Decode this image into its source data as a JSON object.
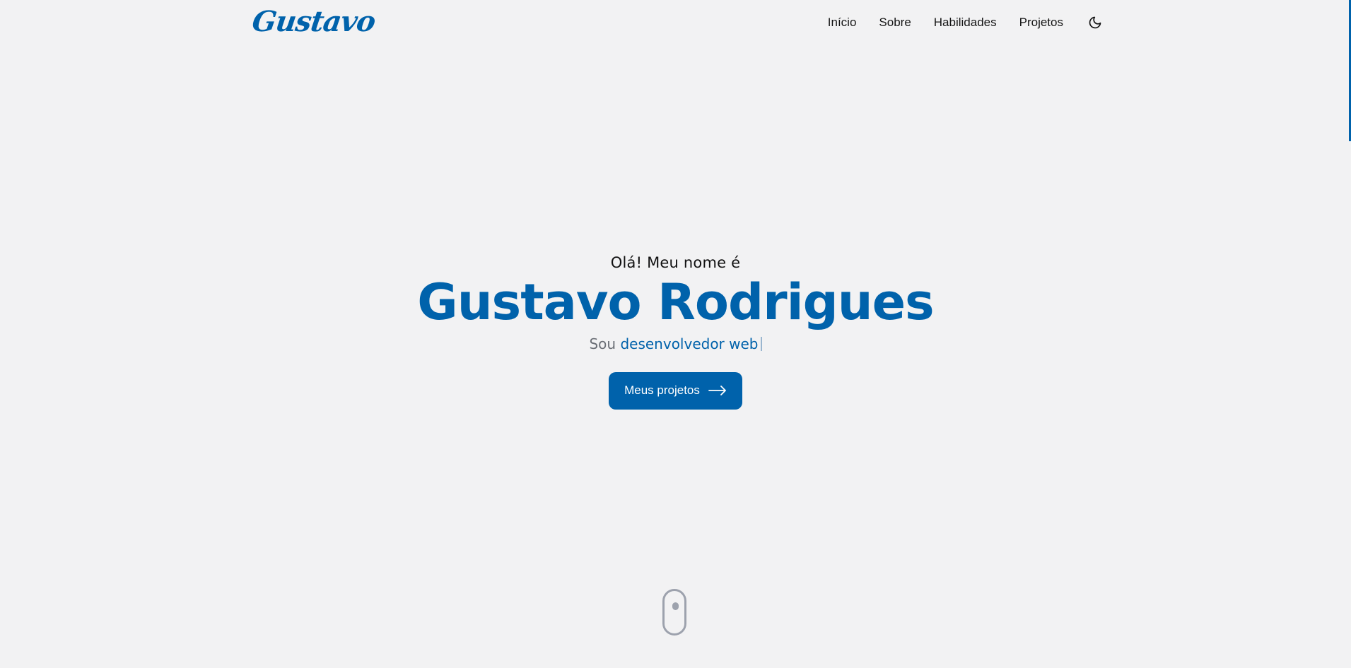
{
  "header": {
    "logo": "Gustavo",
    "nav": [
      "Início",
      "Sobre",
      "Habilidades",
      "Projetos"
    ],
    "theme_toggle_icon": "moon-icon"
  },
  "hero": {
    "greeting": "Olá! Meu nome é",
    "name": "Gustavo Rodrigues",
    "tagline_prefix": "Sou",
    "tagline_role": "desenvolvedor web",
    "cta_label": "Meus projetos",
    "cta_icon": "arrow-right-icon"
  },
  "scroll_icon": "mouse-scroll-icon",
  "colors": {
    "accent": "#0062ab",
    "background": "#f2f2f3",
    "muted": "#6b6f76",
    "mouse": "#9da2ad"
  }
}
